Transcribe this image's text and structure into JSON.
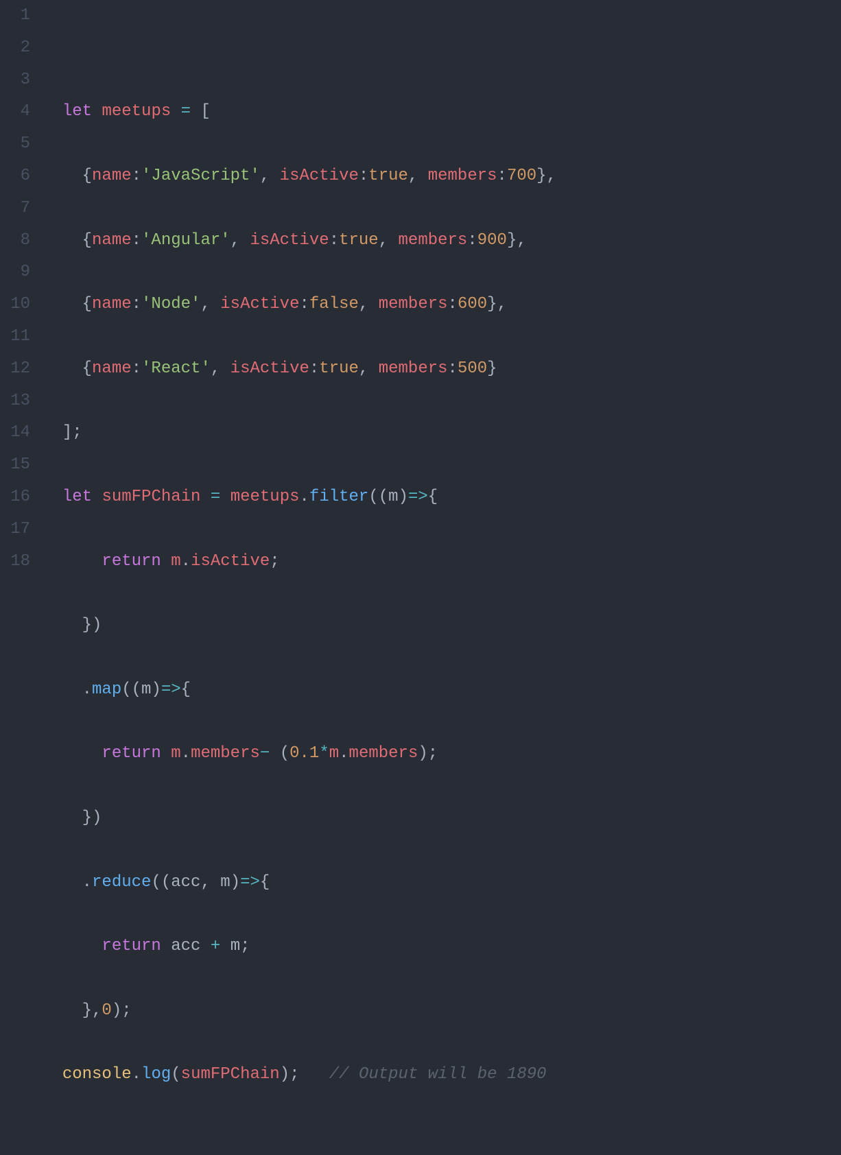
{
  "lineNumbers": [
    "1",
    "2",
    "3",
    "4",
    "5",
    "6",
    "7",
    "8",
    "9",
    "10",
    "11",
    "12",
    "13",
    "14",
    "15",
    "16",
    "17",
    "18"
  ],
  "t": {
    "let": "let",
    "meetups": "meetups",
    "eq": "=",
    "lbrack": "[",
    "rbrack": "]",
    "lbrace": "{",
    "rbrace": "}",
    "lparen": "(",
    "rparen": ")",
    "semi": ";",
    "comma": ",",
    "colon": ":",
    "dot": ".",
    "name": "name",
    "isActive": "isActive",
    "members": "members",
    "sJavaScript": "'JavaScript'",
    "sAngular": "'Angular'",
    "sNode": "'Node'",
    "sReact": "'React'",
    "true": "true",
    "false": "false",
    "n700": "700",
    "n900": "900",
    "n600": "600",
    "n500": "500",
    "n0": "0",
    "n01": "0.1",
    "sumFPChain": "sumFPChain",
    "filter": "filter",
    "map": "map",
    "reduce": "reduce",
    "return": "return",
    "m": "m",
    "acc": "acc",
    "arrow": "=>",
    "minus": "−",
    "star": "*",
    "plus": "+",
    "console": "console",
    "log": "log",
    "comment": "// Output will be 1890"
  }
}
